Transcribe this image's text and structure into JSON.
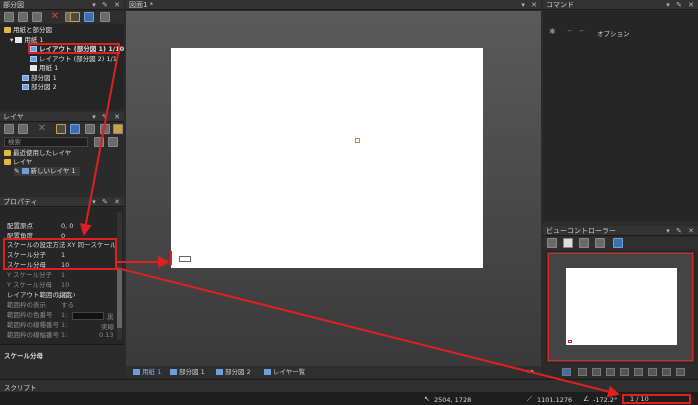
{
  "left_top_panel": {
    "title": "部分図",
    "tree": {
      "root": "用紙と部分図",
      "sheet": "用紙 1",
      "layout1": "レイアウト (部分図 1) 1/10",
      "layout2": "レイアウト (部分図 2) 1/1",
      "sheet_child": "用紙 1",
      "view1": "部分図 1",
      "view2": "部分図 2"
    }
  },
  "layer_panel": {
    "title": "レイヤ",
    "search_placeholder": "検索",
    "recent": "最近使用したレイヤ",
    "layer_group": "レイヤ",
    "new_layer": "新しいレイヤ 1"
  },
  "properties": {
    "title": "プロパティ",
    "rows": [
      {
        "k": "配置原点",
        "v": "0, 0"
      },
      {
        "k": "配置角度",
        "v": "0"
      },
      {
        "k": "スケールの設定方法",
        "v": "XY 同一スケール"
      },
      {
        "k": "スケール分子",
        "v": "1"
      },
      {
        "k": "スケール分母",
        "v": "10"
      },
      {
        "k": "Y スケール分子",
        "v": "1"
      },
      {
        "k": "Y スケール分母",
        "v": "10"
      },
      {
        "k": "レイアウト範囲の指定",
        "v": "しない"
      },
      {
        "k": "範囲枠の表示",
        "v": "する"
      },
      {
        "k": "範囲枠の色番号",
        "v": "1:"
      },
      {
        "k": "範囲枠の線種番号",
        "v": "1:"
      },
      {
        "k": "範囲枠の線幅番号",
        "v": "1:"
      }
    ],
    "color_label": "黒",
    "linetype_label": "実線",
    "linewidth_label": "0.13",
    "description": "スケール分母"
  },
  "drawing": {
    "tab_title": "図面1 *",
    "tabs": [
      "用紙 1",
      "部分図 1",
      "部分図 2",
      "レイヤ一覧"
    ]
  },
  "command_panel": {
    "title": "コマンド",
    "options": "オプション"
  },
  "view_controller": {
    "title": "ビューコントローラー"
  },
  "script_panel": {
    "title": "スクリプト"
  },
  "status": {
    "coords": "2504, 1728",
    "distance": "1101.1276",
    "angle": "-172.2°",
    "scale": "1 / 10"
  },
  "colors": {
    "highlight": "#e02020",
    "canvas_bg": "#4a4a4a",
    "paper": "#ffffff"
  }
}
